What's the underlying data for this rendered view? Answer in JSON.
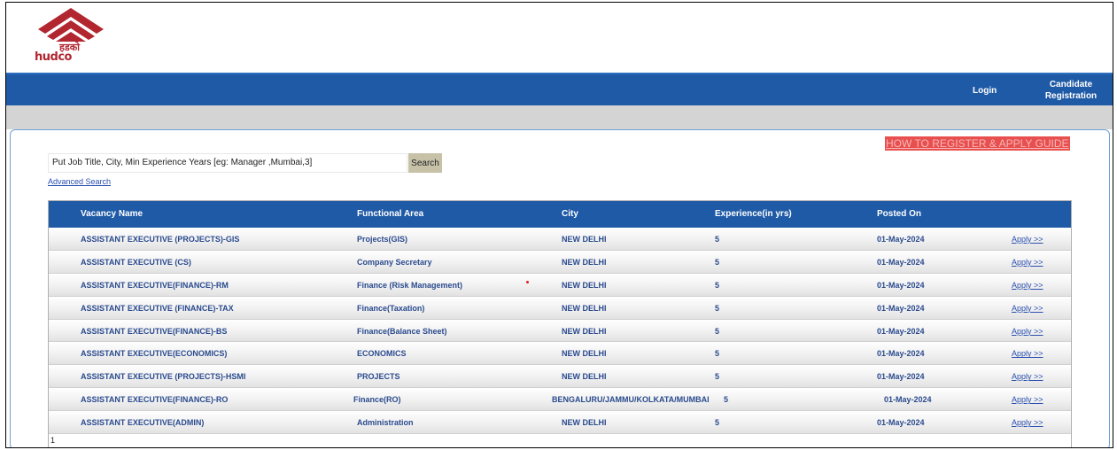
{
  "brand": {
    "logo_text": "hudco",
    "logo_color": "#b1262f"
  },
  "nav": {
    "login": "Login",
    "registration_line1": "Candidate",
    "registration_line2": "Registration",
    "color": "#1f5aa6"
  },
  "guide_link": "HOW TO REGISTER & APPLY GUIDE",
  "search": {
    "value": "Put Job Title, City, Min Experience  Years [eg: Manager ,Mumbai,3]",
    "button": "Search",
    "advanced": "Advanced Search"
  },
  "table": {
    "headers": [
      "Vacancy Name",
      "Functional Area",
      "City",
      "Experience(in yrs)",
      "Posted On"
    ],
    "rows": [
      {
        "name": "ASSISTANT EXECUTIVE (PROJECTS)-GIS",
        "area": "Projects(GIS)",
        "city": "NEW DELHI",
        "exp": "5",
        "posted": "01-May-2024",
        "apply": "Apply >>"
      },
      {
        "name": "ASSISTANT EXECUTIVE (CS)",
        "area": "Company Secretary",
        "city": "NEW DELHI",
        "exp": "5",
        "posted": "01-May-2024",
        "apply": "Apply >>"
      },
      {
        "name": "ASSISTANT EXECUTIVE(FINANCE)-RM",
        "area": "Finance (Risk Management)",
        "city": "NEW DELHI",
        "exp": "5",
        "posted": "01-May-2024",
        "apply": "Apply >>"
      },
      {
        "name": "ASSISTANT EXECUTIVE (FINANCE)-TAX",
        "area": "Finance(Taxation)",
        "city": "NEW DELHI",
        "exp": "5",
        "posted": "01-May-2024",
        "apply": "Apply >>"
      },
      {
        "name": "ASSISTANT EXECUTIVE(FINANCE)-BS",
        "area": "Finance(Balance Sheet)",
        "city": "NEW DELHI",
        "exp": "5",
        "posted": "01-May-2024",
        "apply": "Apply >>"
      },
      {
        "name": "ASSISTANT EXECUTIVE(ECONOMICS)",
        "area": "ECONOMICS",
        "city": "NEW DELHI",
        "exp": "5",
        "posted": "01-May-2024",
        "apply": "Apply >>"
      },
      {
        "name": "ASSISTANT EXECUTIVE (PROJECTS)-HSMI",
        "area": "PROJECTS",
        "city": "NEW DELHI",
        "exp": "5",
        "posted": "01-May-2024",
        "apply": "Apply >>"
      },
      {
        "name": "ASSISTANT EXECUTIVE(FINANCE)-RO",
        "area": "Finance(RO)",
        "city": "BENGALURU/JAMMU/KOLKATA/MUMBAI",
        "exp": "5",
        "posted": "01-May-2024",
        "apply": "Apply >>"
      },
      {
        "name": "ASSISTANT EXECUTIVE(ADMIN)",
        "area": "Administration",
        "city": "NEW DELHI",
        "exp": "5",
        "posted": "01-May-2024",
        "apply": "Apply >>"
      }
    ],
    "page": "1"
  }
}
